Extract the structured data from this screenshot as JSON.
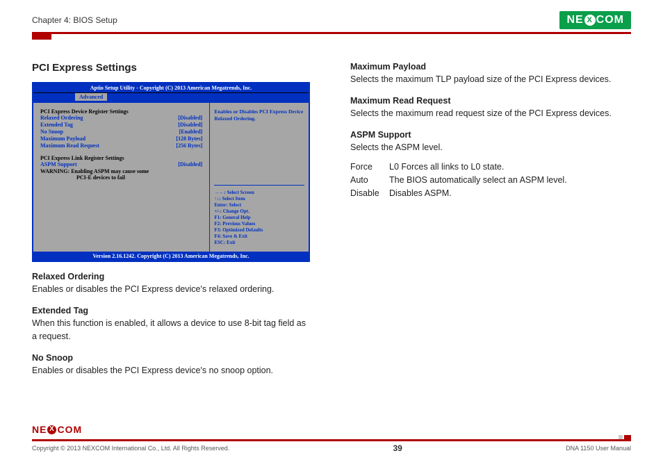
{
  "header": {
    "chapter": "Chapter 4: BIOS Setup",
    "brand_left": "NE",
    "brand_x": "X",
    "brand_right": "COM"
  },
  "left": {
    "section_title": "PCI Express Settings",
    "bios": {
      "top": "Aptio Setup Utility - Copyright (C) 2013 American Megatrends, Inc.",
      "tab": "Advanced",
      "groups": {
        "device_header": "PCI Express Device Register Settings",
        "rows": [
          {
            "label": "Relaxed Ordering",
            "value": "[Disabled]"
          },
          {
            "label": "Extended Tag",
            "value": "[Disabled]"
          },
          {
            "label": "No Snoop",
            "value": "[Enabled]"
          },
          {
            "label": "Maximum Payload",
            "value": "[128 Bytes]"
          },
          {
            "label": "Maximum Read Request",
            "value": "[256 Bytes]"
          }
        ],
        "link_header": "PCI Express Link Register Settings",
        "aspm": {
          "label": "ASPM Support",
          "value": "[Disabled]"
        },
        "warn1": "WARNING:  Enabling ASPM may cause some",
        "warn2": "PCI-E devices to fail"
      },
      "right_desc": "Enables or Disables PCI Express Device Relaxed Ordering.",
      "help_lines": [
        "→←: Select Screen",
        "↑↓: Select Item",
        "Enter: Select",
        "+/-: Change Opt.",
        "F1: General Help",
        "F2: Previous Values",
        "F3: Optimized Defaults",
        "F4: Save & Exit",
        "ESC: Exit"
      ],
      "bottom": "Version 2.16.1242. Copyright (C) 2013 American Megatrends, Inc."
    },
    "paras": [
      {
        "title": "Relaxed Ordering",
        "body": "Enables or disables the PCI Express device's relaxed ordering."
      },
      {
        "title": "Extended Tag",
        "body": "When this function is enabled, it allows a device to use 8-bit tag field as a request."
      },
      {
        "title": "No Snoop",
        "body": "Enables or disables the PCI Express device's no snoop option."
      }
    ]
  },
  "right": {
    "paras": [
      {
        "title": "Maximum Payload",
        "body": "Selects the maximum TLP payload size of the PCI Express devices."
      },
      {
        "title": "Maximum Read Request",
        "body": "Selects the maximum read request size of the PCI Express devices."
      },
      {
        "title": "ASPM Support",
        "body": "Selects the ASPM level."
      }
    ],
    "aspm_rows": [
      {
        "label": "Force",
        "desc": "L0 Forces all links to L0 state."
      },
      {
        "label": "Auto",
        "desc": "The BIOS automatically select an ASPM level."
      },
      {
        "label": "Disable",
        "desc": "Disables ASPM."
      }
    ]
  },
  "footer": {
    "copyright": "Copyright © 2013 NEXCOM International Co., Ltd. All Rights Reserved.",
    "page": "39",
    "doc": "DNA 1150 User Manual"
  }
}
